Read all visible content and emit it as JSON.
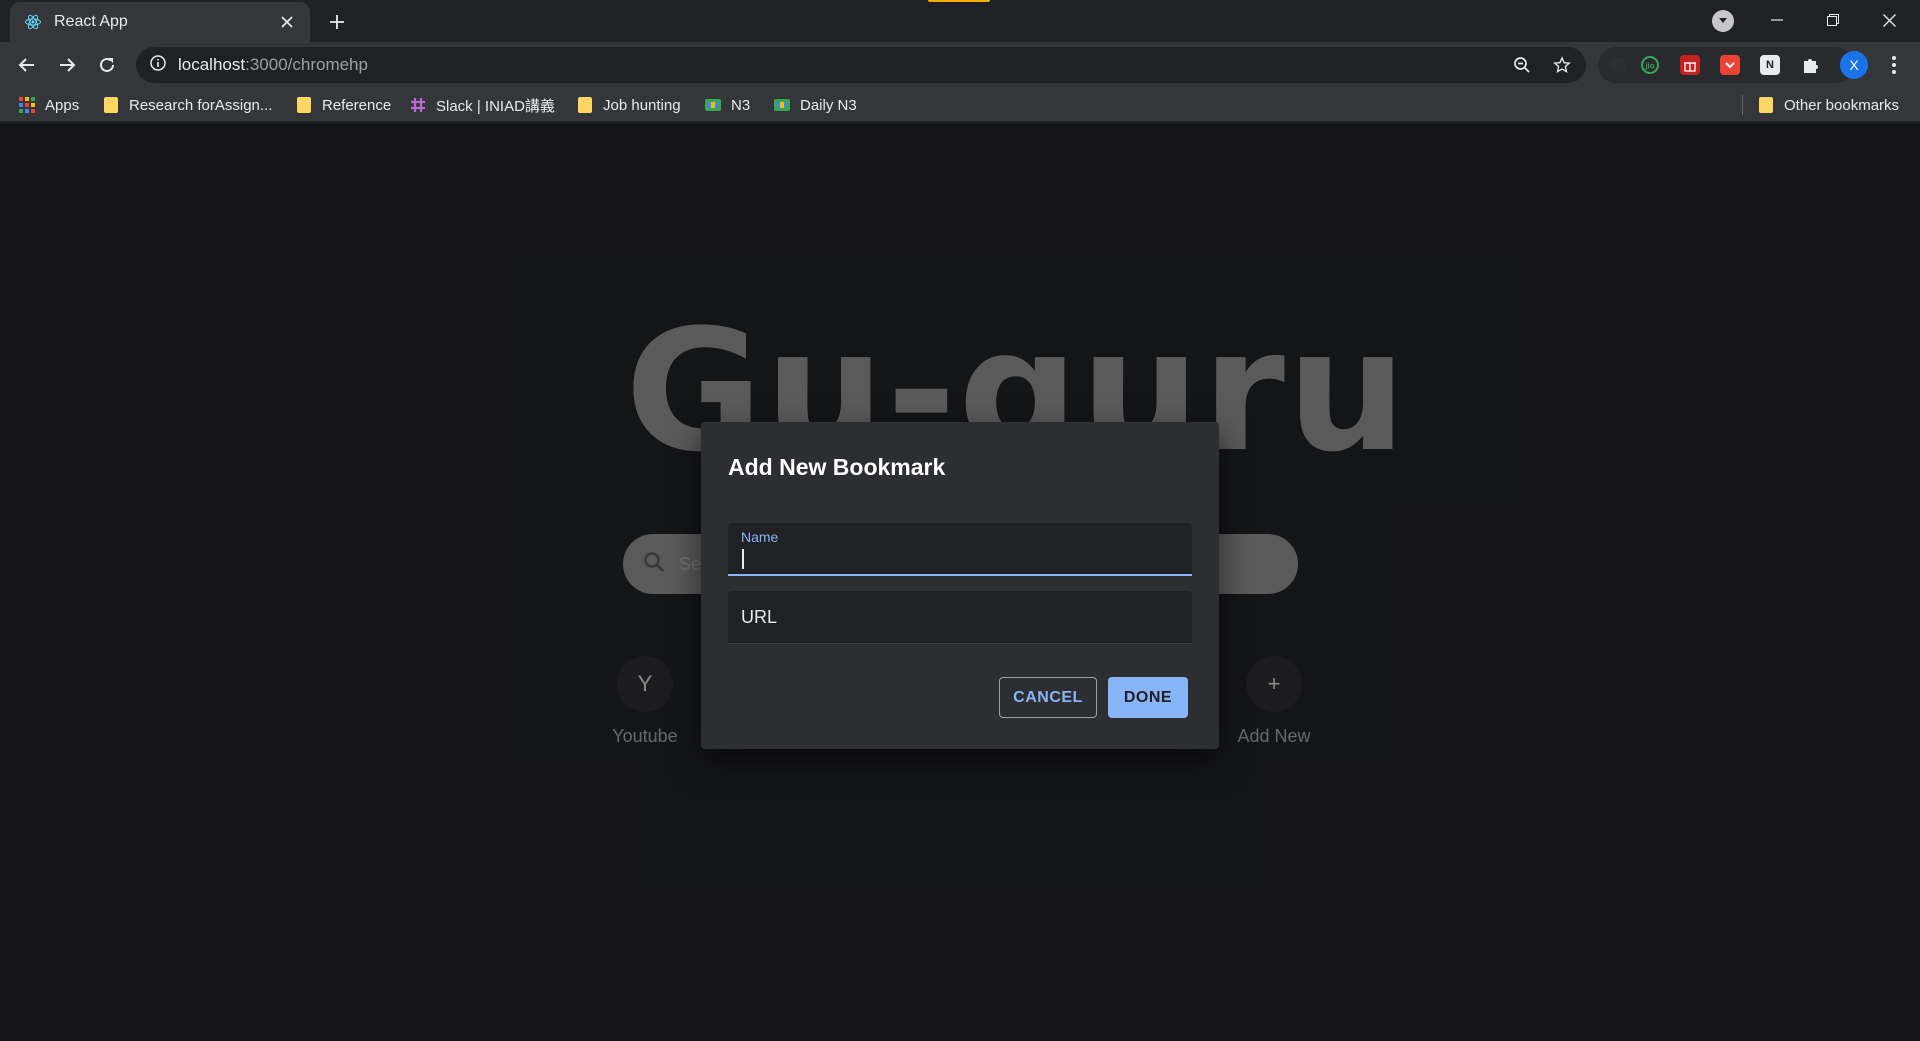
{
  "browser": {
    "tab": {
      "title": "React App"
    },
    "address": {
      "host": "localhost",
      "path": ":3000/chromehp"
    },
    "profile_initial": "X"
  },
  "bookmarks": [
    {
      "label": "Apps",
      "icon": "apps-grid-icon"
    },
    {
      "label": "Research forAssign...",
      "icon": "folder-icon"
    },
    {
      "label": "Reference",
      "icon": "folder-icon"
    },
    {
      "label": "Slack | INIAD講義",
      "icon": "slack-icon"
    },
    {
      "label": "Job hunting",
      "icon": "folder-icon"
    },
    {
      "label": "N3",
      "icon": "bookmark-favicon"
    },
    {
      "label": "Daily N3",
      "icon": "bookmark-favicon"
    }
  ],
  "other_bookmarks": "Other bookmarks",
  "page": {
    "logo": "Gu-guru",
    "search_placeholder": "Se",
    "shortcuts": [
      {
        "initial": "Y",
        "label": "Youtube"
      },
      {
        "initial": "+",
        "label": "Add New"
      }
    ]
  },
  "dialog": {
    "title": "Add New Bookmark",
    "name_label": "Name",
    "name_value": "",
    "url_label": "URL",
    "cancel_label": "CANCEL",
    "done_label": "DONE"
  },
  "colors": {
    "accent": "#8ab4f8",
    "page_bg": "#202124",
    "dialog_bg": "#2d2e31",
    "logo": "#8a8a8a"
  }
}
